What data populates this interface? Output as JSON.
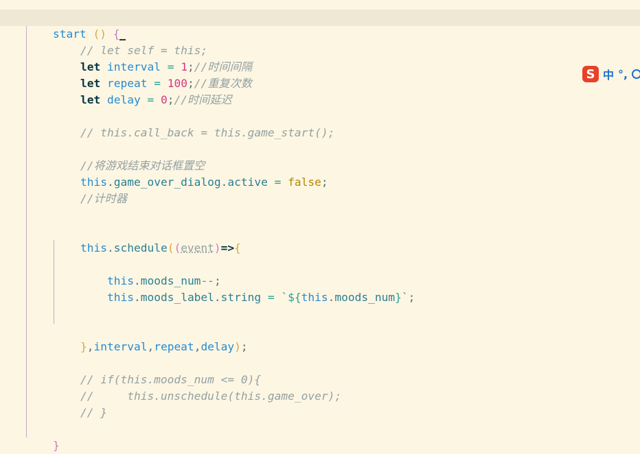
{
  "editor": {
    "colors": {
      "background": "#fdf6e3",
      "current_line": "#eee8d5",
      "keyword": "#073642",
      "identifier": "#268bd2",
      "number": "#d33682",
      "comment": "#93a1a1",
      "literal": "#b58900"
    },
    "lines": {
      "l1": {
        "name": "start",
        "paren": "()",
        "brace": "{"
      },
      "l2": "// let self = this;",
      "l3": {
        "kw": "let",
        "name": "interval",
        "eq": "=",
        "val": "1",
        "end": ";",
        "comment": "//时间间隔"
      },
      "l4": {
        "kw": "let",
        "name": "repeat",
        "eq": "=",
        "val": "100",
        "end": ";",
        "comment": "//重复次数"
      },
      "l5": {
        "kw": "let",
        "name": "delay",
        "eq": "=",
        "val": "0",
        "end": ";",
        "comment": "//时间延迟"
      },
      "l7": "// this.call_back = this.game_start();",
      "l9": "//将游戏结束对话框置空",
      "l10": {
        "this": "this",
        "dot1": ".",
        "obj": "game_over_dialog",
        "dot2": ".",
        "prop": "active",
        "eq": "=",
        "val": "false",
        "end": ";"
      },
      "l11": "//计时器",
      "l14": {
        "this": "this",
        "dot": ".",
        "method": "schedule",
        "p1": "(",
        "p2": "(",
        "arg": "event",
        "p3": ")",
        "arrow": "=>",
        "brace": "{"
      },
      "l16": {
        "this": "this",
        "dot": ".",
        "prop": "moods_num",
        "op": "--",
        "end": ";"
      },
      "l17": {
        "this": "this",
        "dot1": ".",
        "obj": "moods_label",
        "dot2": ".",
        "prop": "string",
        "eq": "=",
        "tpl_open": "`${",
        "tpl_this": "this",
        "tpl_dot": ".",
        "tpl_prop": "moods_num",
        "tpl_close": "}`",
        "end": ";"
      },
      "l20": {
        "brace": "}",
        "c1": ",",
        "a1": "interval",
        "c2": ",",
        "a2": "repeat",
        "c3": ",",
        "a3": "delay",
        "close": ")",
        "end": ";"
      },
      "l22": "// if(this.moods_num <= 0){",
      "l23": "//     this.unschedule(this.game_over);",
      "l24": "// }",
      "l26": "}"
    }
  },
  "ime": {
    "logo": "S",
    "mode": "中",
    "punct": "°,"
  }
}
